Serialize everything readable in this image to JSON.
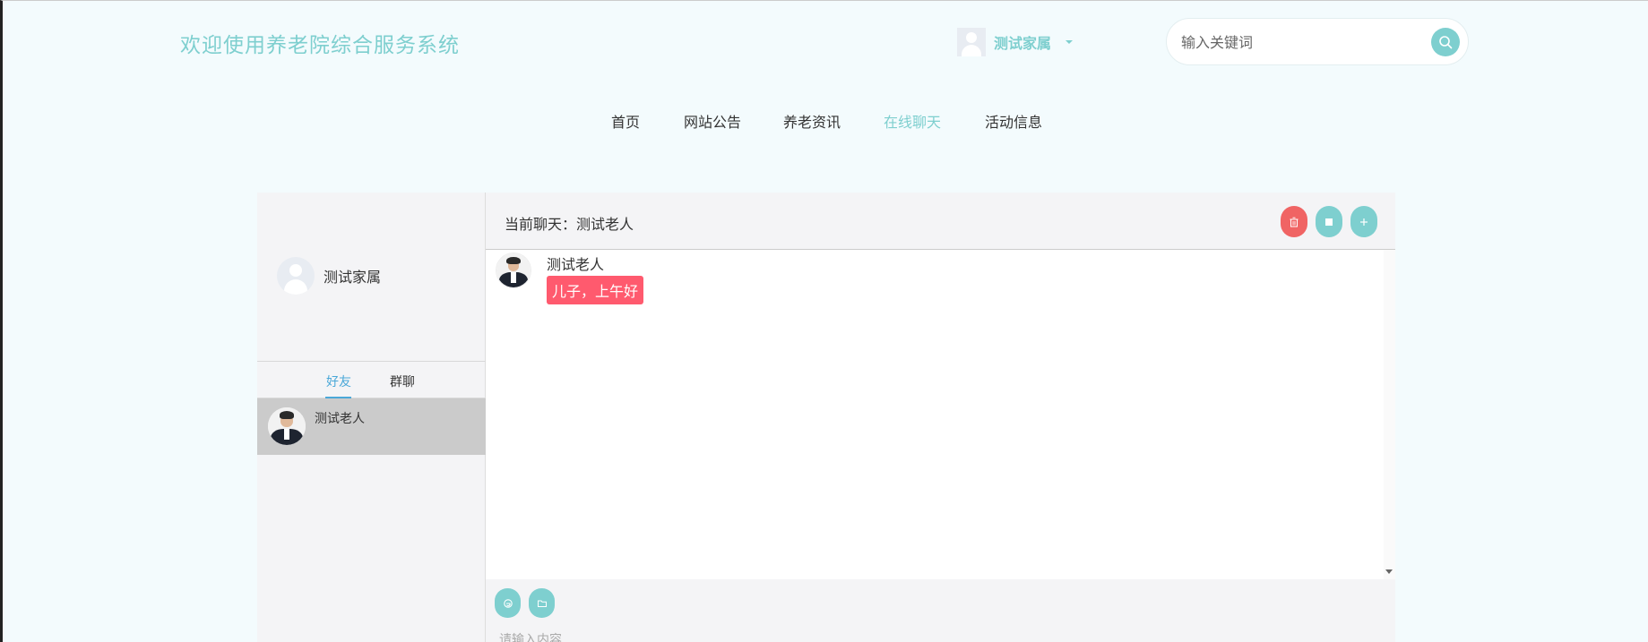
{
  "header": {
    "site_title": "欢迎使用养老院综合服务系统",
    "user_name": "测试家属",
    "search": {
      "placeholder": "输入关键词",
      "value": ""
    }
  },
  "nav": {
    "items": [
      {
        "label": "首页",
        "active": false
      },
      {
        "label": "网站公告",
        "active": false
      },
      {
        "label": "养老资讯",
        "active": false
      },
      {
        "label": "在线聊天",
        "active": true
      },
      {
        "label": "活动信息",
        "active": false
      }
    ]
  },
  "chat": {
    "me_name": "测试家属",
    "tabs": [
      {
        "label": "好友",
        "active": true
      },
      {
        "label": "群聊",
        "active": false
      }
    ],
    "friends": [
      {
        "name": "测试老人"
      }
    ],
    "current_chat": "当前聊天：测试老人",
    "messages": [
      {
        "sender": "测试老人",
        "text": "儿子，上午好"
      }
    ],
    "composer": {
      "placeholder": "请输入内容",
      "value": ""
    }
  },
  "colors": {
    "accent": "#7ecfcf",
    "danger": "#f06464",
    "bubble": "#ff5a6e",
    "tab_active": "#4aa8d8",
    "page_bg": "#f3fbfd"
  },
  "icons": {
    "search": "search-icon",
    "delete": "trash-icon",
    "stop": "square-icon",
    "add": "plus-icon",
    "emoji": "emoji-icon",
    "file": "folder-icon"
  }
}
